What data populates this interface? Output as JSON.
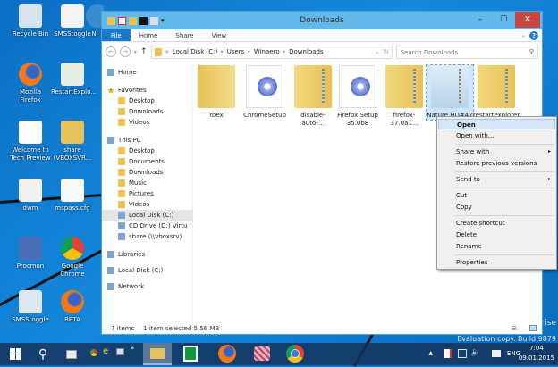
{
  "desktop": {
    "icons": [
      {
        "label": "Recycle Bin",
        "icon": "recycle-bin-icon"
      },
      {
        "label": "SMSStoggle",
        "icon": "script-icon"
      },
      {
        "label": "Mozilla Firefox",
        "icon": "firefox-icon"
      },
      {
        "label": "RestartExplo...",
        "icon": "app-window-icon"
      },
      {
        "label": "Welcome to Tech Preview",
        "icon": "windows-logo-icon"
      },
      {
        "label": "share (VBOXSVR...",
        "icon": "network-folder-icon"
      },
      {
        "label": "dwm",
        "icon": "text-file-icon"
      },
      {
        "label": "mspass.cfg",
        "icon": "file-icon"
      },
      {
        "label": "Procmon",
        "icon": "procmon-icon"
      },
      {
        "label": "Google Chrome",
        "icon": "chrome-icon"
      },
      {
        "label": "SMSStoggle",
        "icon": "settings-app-icon"
      },
      {
        "label": "BETA",
        "icon": "firefox-icon"
      }
    ],
    "partial_icon_label": "Ni",
    "watermark": [
      "erprise",
      "Evaluation copy. Build 9879"
    ]
  },
  "window": {
    "title": "Downloads",
    "controls": {
      "minimize": "–",
      "maximize": "☐",
      "close": "✕"
    },
    "ribbon_tabs": [
      "File",
      "Home",
      "Share",
      "View"
    ],
    "address": {
      "prefix": "«",
      "crumbs": [
        "Local Disk (C:)",
        "Users",
        "Winaero",
        "Downloads"
      ]
    },
    "search_placeholder": "Search Downloads",
    "nav": [
      {
        "label": "Home",
        "level": 0,
        "icon": "home-icon"
      },
      {
        "label": "Favorites",
        "level": 0,
        "icon": "star-icon"
      },
      {
        "label": "Desktop",
        "level": 1,
        "icon": "desktop-folder-icon"
      },
      {
        "label": "Downloads",
        "level": 1,
        "icon": "downloads-folder-icon"
      },
      {
        "label": "Videos",
        "level": 1,
        "icon": "videos-folder-icon"
      },
      {
        "label": "This PC",
        "level": 0,
        "icon": "computer-icon"
      },
      {
        "label": "Desktop",
        "level": 1,
        "icon": "desktop-folder-icon"
      },
      {
        "label": "Documents",
        "level": 1,
        "icon": "documents-folder-icon"
      },
      {
        "label": "Downloads",
        "level": 1,
        "icon": "downloads-folder-icon"
      },
      {
        "label": "Music",
        "level": 1,
        "icon": "music-folder-icon"
      },
      {
        "label": "Pictures",
        "level": 1,
        "icon": "pictures-folder-icon"
      },
      {
        "label": "Videos",
        "level": 1,
        "icon": "videos-folder-icon"
      },
      {
        "label": "Local Disk (C:)",
        "level": 1,
        "icon": "drive-icon",
        "selected": true
      },
      {
        "label": "CD Drive (D:) Virtu",
        "level": 1,
        "icon": "cd-drive-icon"
      },
      {
        "label": "share (\\\\vboxsrv)",
        "level": 1,
        "icon": "network-drive-icon"
      },
      {
        "label": "Libraries",
        "level": 0,
        "icon": "libraries-icon"
      },
      {
        "label": "Local Disk (C:)",
        "level": 0,
        "icon": "drive-icon"
      },
      {
        "label": "Network",
        "level": 0,
        "icon": "network-icon"
      }
    ],
    "files": [
      {
        "name": "roex",
        "type": "folder"
      },
      {
        "name": "ChromeSetup",
        "type": "setup"
      },
      {
        "name": "disable-auto-...",
        "type": "zip"
      },
      {
        "name": "Firefox Setup 35.0b8",
        "type": "setup"
      },
      {
        "name": "firefox-37.0a1...",
        "type": "zip"
      },
      {
        "name": "Nature HD#47",
        "type": "zip-images",
        "selected": true
      },
      {
        "name": "restartexplorer",
        "type": "zip"
      }
    ],
    "status": {
      "count": "7 items",
      "selection": "1 item selected  5,56 MB"
    }
  },
  "context_menu": {
    "items": [
      {
        "label": "Open",
        "highlighted": true
      },
      {
        "label": "Open with..."
      },
      {
        "label": "Share with",
        "submenu": true
      },
      {
        "label": "Restore previous versions"
      },
      {
        "label": "Send to",
        "submenu": true
      },
      {
        "label": "Cut"
      },
      {
        "label": "Copy"
      },
      {
        "label": "Create shortcut"
      },
      {
        "label": "Delete"
      },
      {
        "label": "Rename"
      },
      {
        "label": "Properties"
      }
    ],
    "submenu_arrow": "▸"
  },
  "taskbar": {
    "apps": [
      "start-icon",
      "search-icon",
      "task-view-icon",
      "chrome-small-icon",
      "ie-icon",
      "photo-viewer-icon",
      "overflow-icon",
      "file-explorer-icon",
      "store-icon",
      "firefox-icon",
      "app-cubes-icon",
      "chrome-icon"
    ],
    "overflow": "»",
    "tray": {
      "lang": "ENG",
      "time": "7:04",
      "date": "09.01.2015"
    }
  },
  "colors": {
    "desktop": "#0b74c9",
    "titlebar": "#63b8ea",
    "file_tab": "#1979ca",
    "selection": "#cce8ff",
    "close": "#c9453f"
  }
}
